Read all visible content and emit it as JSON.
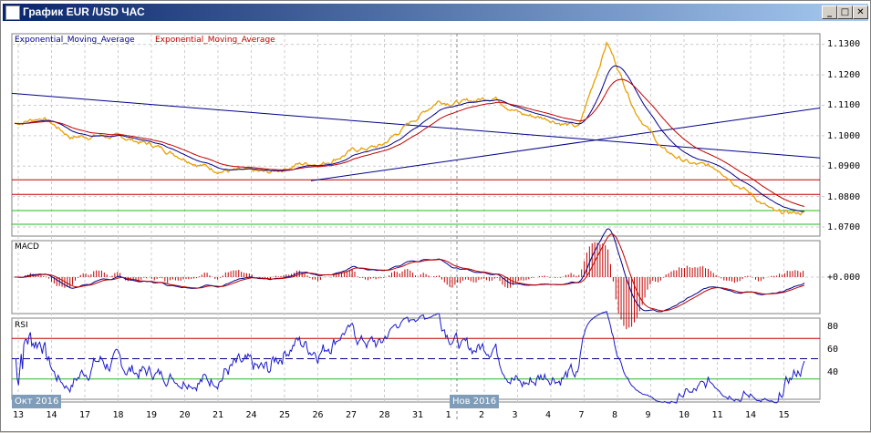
{
  "window": {
    "title": "График EUR /USD  ЧАС",
    "minimize": "_",
    "maximize": "□",
    "close": "✕"
  },
  "legend": {
    "ema1": "Exponential_Moving_Average",
    "ema2": "Exponential_Moving_Average",
    "ema1_color": "#00008b",
    "ema2_color": "#c00000"
  },
  "indicators": {
    "macd": "MACD",
    "rsi": "RSI"
  },
  "price_axis": [
    "1.1300",
    "1.1200",
    "1.1100",
    "1.1000",
    "1.0900",
    "1.0800",
    "1.0700"
  ],
  "macd_axis": "+0.000",
  "rsi_axis": [
    "80",
    "60",
    "40"
  ],
  "months": [
    "Окт 2016",
    "Нов 2016"
  ],
  "dates": [
    "13",
    "14",
    "17",
    "18",
    "19",
    "20",
    "21",
    "24",
    "25",
    "26",
    "27",
    "28",
    "31",
    "1",
    "2",
    "3",
    "4",
    "7",
    "8",
    "9",
    "10",
    "11",
    "14",
    "15"
  ],
  "chart_data": {
    "type": "line",
    "price_anchors": [
      1.104,
      1.1061,
      1.0996,
      1.1001,
      1.099,
      1.0966,
      1.093,
      1.0891,
      1.0882,
      1.0876,
      1.0906,
      1.0912,
      1.0951,
      1.0966,
      1.104,
      1.1115,
      1.1109,
      1.113,
      1.107,
      1.1055,
      1.1025,
      1.1309,
      1.1085,
      1.0951,
      1.0906,
      1.0891,
      1.0816,
      1.0742,
      1.0748
    ],
    "ylim": [
      1.067,
      1.1335
    ],
    "levels_red": [
      1.0855,
      1.0807
    ],
    "levels_green": [
      1.0754,
      1.0709
    ],
    "trendlines": [
      [
        1.1139,
        1.0927
      ],
      [
        1.0852,
        1.1091
      ]
    ],
    "rsi_levels": [
      70,
      50,
      30
    ]
  }
}
